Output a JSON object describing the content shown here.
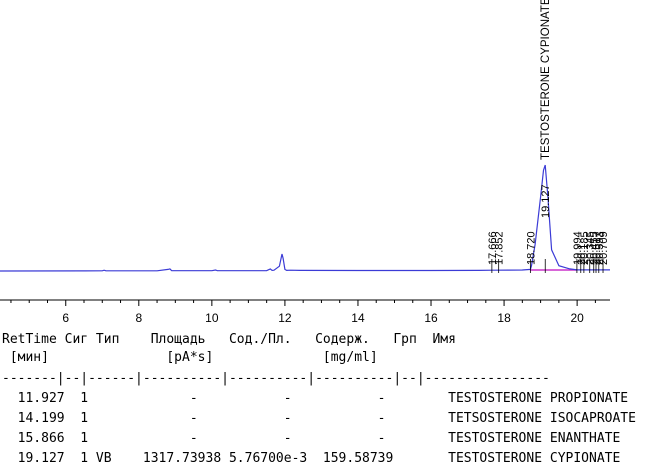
{
  "chart_data": {
    "type": "line",
    "xlim": [
      4.2,
      20.9
    ],
    "x_ticks": [
      6,
      8,
      10,
      12,
      14,
      16,
      18,
      20
    ],
    "series": [
      {
        "x": [
          4.2,
          6.5,
          7.0,
          7.05,
          7.1,
          8.5,
          8.8,
          8.85,
          8.9,
          10.0,
          10.1,
          10.15,
          11.5,
          11.6,
          11.65,
          11.7,
          11.85,
          11.92,
          11.95,
          12.0,
          12.05,
          12.15,
          12.4,
          14.0,
          16.0,
          17.3,
          17.7,
          18.5,
          18.72,
          18.75,
          18.85,
          19.0,
          19.08,
          19.127,
          19.2,
          19.3,
          19.5,
          19.8,
          20.0,
          20.9
        ],
        "y": [
          0.0,
          0.1,
          0.2,
          0.8,
          0.2,
          0.2,
          1.5,
          2.0,
          0.3,
          0.3,
          0.9,
          0.3,
          0.3,
          2.0,
          0.6,
          0.8,
          4.5,
          16.0,
          12.0,
          1.5,
          0.6,
          0.8,
          0.6,
          0.5,
          0.5,
          0.6,
          0.8,
          0.9,
          1.5,
          5.0,
          25.0,
          70.0,
          95.0,
          100.0,
          70.0,
          20.0,
          5.0,
          2.0,
          1.0,
          1.0
        ]
      }
    ],
    "peak_labels": [
      {
        "x": 17.666,
        "text": "17.666"
      },
      {
        "x": 17.852,
        "text": "17.852"
      },
      {
        "x": 18.72,
        "text": "18.720"
      },
      {
        "x": 19.127,
        "text": "19.127"
      },
      {
        "x": 19.994,
        "text": "19.994"
      },
      {
        "x": 20.1,
        "text": "20.1"
      },
      {
        "x": 20.185,
        "text": "20.185"
      },
      {
        "x": 20.345,
        "text": "20.345"
      },
      {
        "x": 20.455,
        "text": "20.455"
      },
      {
        "x": 20.517,
        "text": "20.517"
      },
      {
        "x": 20.593,
        "text": "20.593"
      },
      {
        "x": 20.709,
        "text": "20.709"
      }
    ],
    "compound_label": {
      "x": 19.127,
      "text": "TESTOSTERONE CYPIONATE"
    }
  },
  "report": {
    "header1": "RetTime Сиг Тип    Площадь   Сод./Пл.   Содерж.   Грп  Имя",
    "header2": " [мин]               [pA*s]              [mg/ml]",
    "separator": "-------|--|------|----------|----------|----------|--|----------------",
    "rows": [
      "  11.927  1             -           -           -        TESTOSTERONE PROPIONATE",
      "  14.199  1             -           -           -        TETSOSTERONE ISOCAPROATE",
      "  15.866  1             -           -           -        TESTOSTERONE ENANTHATE",
      "  19.127  1 VB    1317.73938 5.76700e-3  159.58739       TESTOSTERONE CYPIONATE"
    ]
  },
  "colors": {
    "trace": "#3b3bd6",
    "baseline": "#cc33cc",
    "axis": "#000000"
  }
}
